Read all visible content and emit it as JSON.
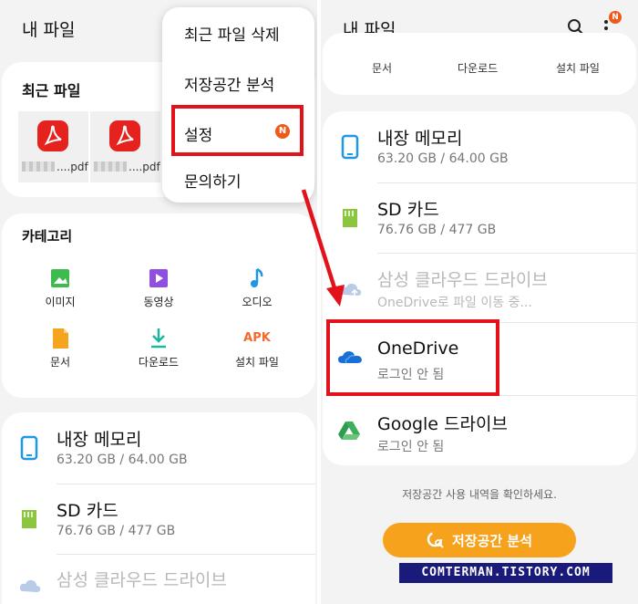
{
  "left": {
    "app_title": "내 파일",
    "recent": {
      "title": "최근 파일",
      "files": [
        {
          "icon": "pdf-icon",
          "name_suffix": "....pdf"
        },
        {
          "icon": "pdf-icon",
          "name_suffix": "....pdf"
        }
      ]
    },
    "categories": {
      "title": "카테고리",
      "items": [
        {
          "label": "이미지",
          "icon": "image-icon",
          "color": "#3dbb4e"
        },
        {
          "label": "동영상",
          "icon": "video-icon",
          "color": "#8e4fe0"
        },
        {
          "label": "오디오",
          "icon": "audio-icon",
          "color": "#1e98e6"
        },
        {
          "label": "문서",
          "icon": "document-icon",
          "color": "#f5a41d"
        },
        {
          "label": "다운로드",
          "icon": "download-icon",
          "color": "#1ab6a0"
        },
        {
          "label": "설치 파일",
          "icon": "apk-icon",
          "icon_text": "APK",
          "color": "#f26a2e"
        }
      ]
    },
    "storage": [
      {
        "name": "내장 메모리",
        "sub": "63.20 GB / 64.00 GB"
      },
      {
        "name": "SD 카드",
        "sub": "76.76 GB / 477 GB"
      },
      {
        "name": "삼성 클라우드 드라이브"
      }
    ],
    "menu": {
      "items": [
        "최근 파일 삭제",
        "저장공간 분석",
        "설정",
        "문의하기"
      ],
      "badge": "N"
    }
  },
  "right": {
    "app_title": "내 파일",
    "header_badge": "N",
    "cat_strip": [
      "문서",
      "다운로드",
      "설치 파일"
    ],
    "storage": [
      {
        "name": "내장 메모리",
        "sub": "63.20 GB / 64.00 GB",
        "icon_color": "#1e98e6"
      },
      {
        "name": "SD 카드",
        "sub": "76.76 GB / 477 GB",
        "icon_color": "#8cc63f"
      },
      {
        "name": "삼성 클라우드 드라이브",
        "sub": "OneDrive로 파일 이동 중...",
        "icon_color": "#9bb8e0"
      },
      {
        "name": "OneDrive",
        "sub": "로그인 안 됨",
        "icon_color": "#1a6fd1"
      },
      {
        "name": "Google 드라이브",
        "sub": "로그인 안 됨",
        "icon_color": "#3cae5c"
      }
    ],
    "notice": "저장공간 사용 내역을 확인하세요.",
    "analyze_button": "저장공간 분석"
  },
  "watermark": "COMTERMAN.TISTORY.COM",
  "colors": {
    "highlight": "#e3121a",
    "accent_orange": "#f6a21c"
  }
}
